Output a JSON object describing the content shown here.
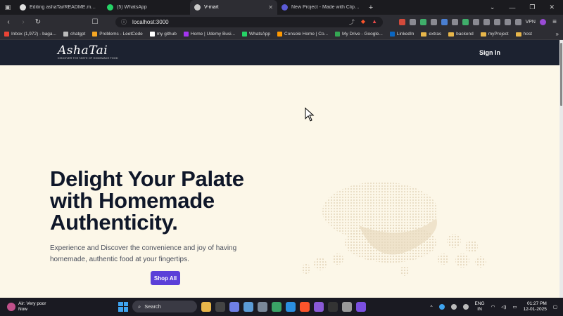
{
  "browser": {
    "tabs": [
      {
        "title": "Editing ashaTai/README.md at ma",
        "favicon_color": "#e0e0e0",
        "active": false
      },
      {
        "title": "(5) WhatsApp",
        "favicon_color": "#25d366",
        "active": false
      },
      {
        "title": "V-mart",
        "favicon_color": "#c9c9c9",
        "active": true
      },
      {
        "title": "New Project - Made with Clipchamp",
        "favicon_color": "#5b5bd6",
        "active": false
      }
    ],
    "new_tab": "+",
    "url": "localhost:3000",
    "vpn_label": "VPN",
    "bookmarks": [
      {
        "label": "Inbox (1,972) - baga...",
        "icon": "gmail-icon",
        "color": "#ea4335"
      },
      {
        "label": "chatgpt",
        "icon": "chatgpt-icon",
        "color": "#bbbbbb"
      },
      {
        "label": "Problems - LeetCode",
        "icon": "leetcode-icon",
        "color": "#f5a623"
      },
      {
        "label": "my github",
        "icon": "github-icon",
        "color": "#ffffff"
      },
      {
        "label": "Home | Udemy Busi...",
        "icon": "udemy-icon",
        "color": "#a435f0"
      },
      {
        "label": "WhatsApp",
        "icon": "whatsapp-icon",
        "color": "#25d366"
      },
      {
        "label": "Console Home | Co...",
        "icon": "aws-icon",
        "color": "#ff9900"
      },
      {
        "label": "My Drive - Google...",
        "icon": "drive-icon",
        "color": "#34a853"
      },
      {
        "label": "LinkedIn",
        "icon": "linkedin-icon",
        "color": "#0a66c2"
      },
      {
        "label": "extras",
        "icon": "folder-icon",
        "color": "#e8b64a"
      },
      {
        "label": "backend",
        "icon": "folder-icon",
        "color": "#e8b64a"
      },
      {
        "label": "myProject",
        "icon": "folder-icon",
        "color": "#e8b64a"
      },
      {
        "label": "host",
        "icon": "folder-icon",
        "color": "#e8b64a"
      }
    ]
  },
  "site": {
    "logo": "AshaTai",
    "logo_tagline": "DISCOVER THE TASTE OF HOMEMADE FOOD",
    "signin": "Sign In",
    "hero": {
      "title": "Delight Your Palate with Homemade Authenticity.",
      "subtitle": "Experience and Discover the convenience and joy of having homemade, authentic food at your fingertips.",
      "cta": "Shop All"
    },
    "colors": {
      "header_bg": "#1c2230",
      "page_bg": "#fcf7e8",
      "cta_bg": "#5b3fd8",
      "heading": "#0f1729"
    }
  },
  "taskbar": {
    "weather_title": "Air: Very poor",
    "weather_sub": "Now",
    "search_placeholder": "Search",
    "lang_top": "ENG",
    "lang_bottom": "IN",
    "time": "01:27 PM",
    "date": "12-01-2025"
  }
}
